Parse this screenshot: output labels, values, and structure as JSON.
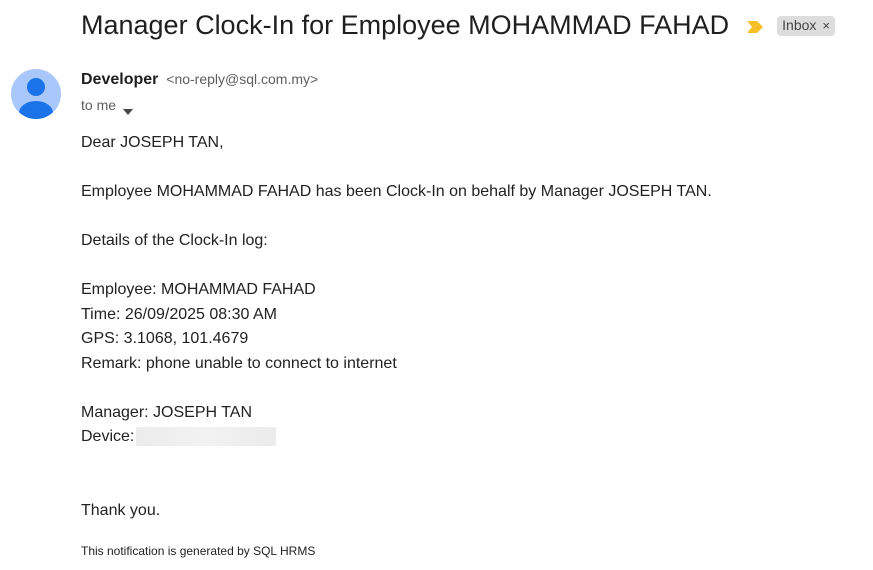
{
  "email": {
    "subject": "Manager Clock-In for Employee MOHAMMAD FAHAD",
    "importance_icon": "importance-marker-icon",
    "label": {
      "text": "Inbox",
      "remove": "×"
    },
    "sender": {
      "name": "Developer",
      "email": "<no-reply@sql.com.my>"
    },
    "recipient": "to me",
    "body": {
      "greeting": "Dear JOSEPH TAN,",
      "intro": "Employee MOHAMMAD FAHAD has been Clock-In on behalf by Manager JOSEPH TAN.",
      "details_heading": "Details of the Clock-In log:",
      "employee": "Employee: MOHAMMAD FAHAD",
      "time": "Time: 26/09/2025 08:30 AM",
      "gps": "GPS: 3.1068, 101.4679",
      "remark": "Remark: phone unable to connect to internet",
      "manager": "Manager: JOSEPH TAN",
      "device_label": "Device:",
      "closing": "Thank you."
    },
    "footer": "This notification is generated by SQL HRMS"
  },
  "colors": {
    "importance": "#f6c026",
    "avatar_bg": "#a8c7fa",
    "avatar_fg": "#1a73e8",
    "chip_bg": "#dddddd"
  }
}
